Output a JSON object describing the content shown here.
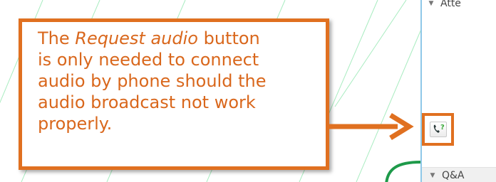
{
  "side_panel": {
    "attendees_header": "Atte",
    "qa_header": "Q&A",
    "accent_color": "#8fc8e8"
  },
  "callout": {
    "text_before": "The ",
    "text_emphasis": "Request audio",
    "text_after": " button\nis only needed to connect\naudio by phone should the\naudio broadcast not work\nproperly.",
    "border_color": "#e07020",
    "text_color": "#d9671c"
  },
  "request_audio_button": {
    "icon": "phone-question-icon",
    "highlight_color": "#e07020"
  },
  "decor": {
    "line_color": "#8fe0a8",
    "curve_color": "#1e9a4a"
  }
}
